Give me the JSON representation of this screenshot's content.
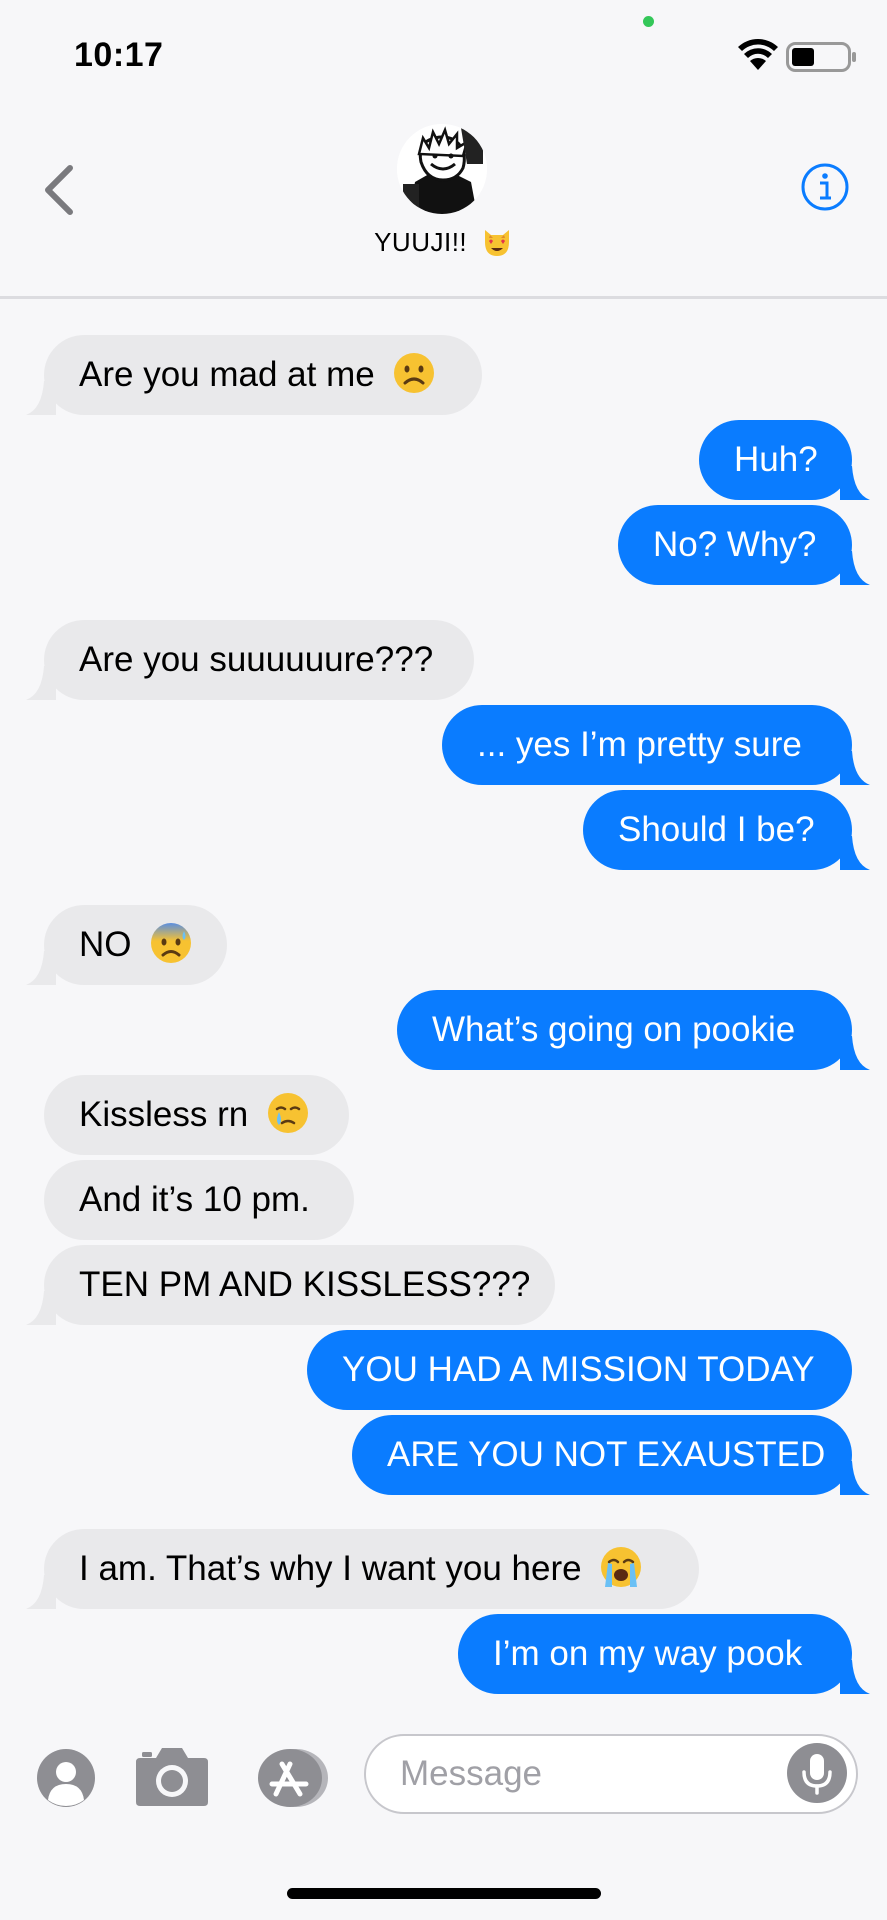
{
  "status_bar": {
    "time": "10:17"
  },
  "header": {
    "contact_name": "YUUJI!!"
  },
  "messages": [
    {
      "dir": "in",
      "text": "Are you mad at me",
      "emoji": "frowning-face"
    },
    {
      "dir": "out",
      "text": "Huh?"
    },
    {
      "dir": "out",
      "text": "No? Why?"
    },
    {
      "dir": "in",
      "text": "Are you suuuuuure???"
    },
    {
      "dir": "out",
      "text": "... yes I’m pretty sure"
    },
    {
      "dir": "out",
      "text": "Should I be?"
    },
    {
      "dir": "in",
      "text": "NO",
      "emoji": "anxious-sweat-face"
    },
    {
      "dir": "out",
      "text": "What’s going on pookie"
    },
    {
      "dir": "in",
      "text": "Kissless rn",
      "emoji": "holding-back-tears-face"
    },
    {
      "dir": "in",
      "text": "And it’s 10 pm."
    },
    {
      "dir": "in",
      "text": "TEN PM AND KISSLESS???"
    },
    {
      "dir": "out",
      "text": "YOU HAD A MISSION TODAY"
    },
    {
      "dir": "out",
      "text": "ARE YOU NOT EXAUSTED"
    },
    {
      "dir": "in",
      "text": "I am. That’s why I want you here",
      "emoji": "loudly-crying-face"
    },
    {
      "dir": "out",
      "text": "I’m on my way pook"
    }
  ],
  "input_bar": {
    "placeholder": "Message"
  },
  "colors": {
    "outgoing": "#0a7cff",
    "incoming": "#e9e9eb",
    "accent": "#0a7cff"
  }
}
